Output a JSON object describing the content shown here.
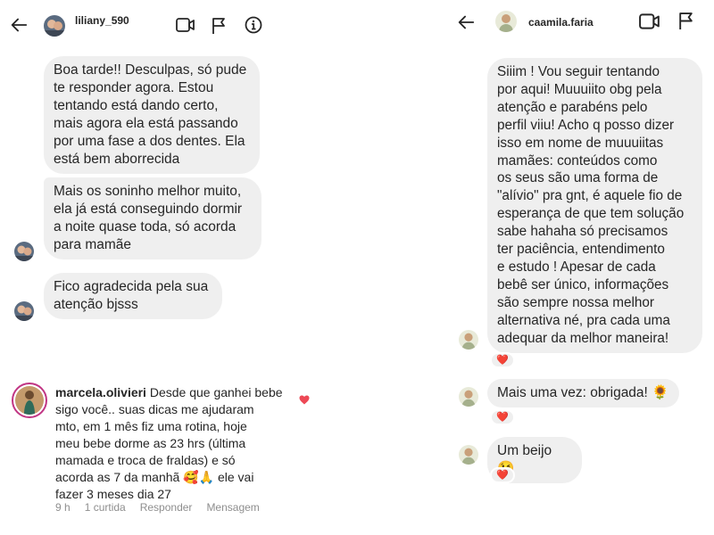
{
  "left_chat": {
    "header": {
      "username": "liliany_590",
      "icons": [
        "back-arrow-icon",
        "video-call-icon",
        "flag-icon",
        "info-icon"
      ]
    },
    "messages": [
      "Boa tarde!! Desculpas, só pude\nte responder agora. Estou\ntentando está dando certo,\nmais agora ela está passando\npor uma fase a dos dentes. Ela\nestá bem aborrecida",
      "Mais os soninho melhor muito,\nela já está conseguindo dormir\na noite quase toda, só acorda\npara mamãe",
      "Fico agradecida pela sua\natenção bjsss"
    ]
  },
  "comment": {
    "username": "marcela.olivieri",
    "text": " Desde que ganhei bebe\nsigo você.. suas dicas me ajudaram\nmto, em 1 mês fiz uma rotina, hoje\nmeu bebe dorme as 23 hrs (última\nmamada e troca de fraldas) e só\nacorda as 7 da manhã 🥰🙏 ele vai\nfazer 3 meses dia 27",
    "time": "9 h",
    "likes": "1 curtida",
    "reply": "Responder",
    "message": "Mensagem",
    "heart_color": "#ed4956"
  },
  "right_chat": {
    "header": {
      "username": "caamila.faria",
      "icons": [
        "back-arrow-icon",
        "video-call-icon",
        "flag-icon"
      ]
    },
    "messages": [
      "Siiim ! Vou seguir tentando\npor aqui! Muuuiito obg pela\natenção e parabéns pelo\nperfil viiu! Acho q posso dizer\nisso em nome de muuuiitas\nmamães: conteúdos como\nos seus são uma forma de\n\"alívio\" pra gnt, é aquele fio de\nesperança de que tem solução\nsabe hahaha só precisamos\nter paciência, entendimento\ne estudo ! Apesar de cada\nbebê ser único, informações\nsão sempre nossa melhor\nalternativa né, pra cada uma\nadequar da melhor maneira!",
      "Mais uma vez: obrigada! 🌻",
      "Um beijo 😘"
    ],
    "reaction": "❤️"
  }
}
